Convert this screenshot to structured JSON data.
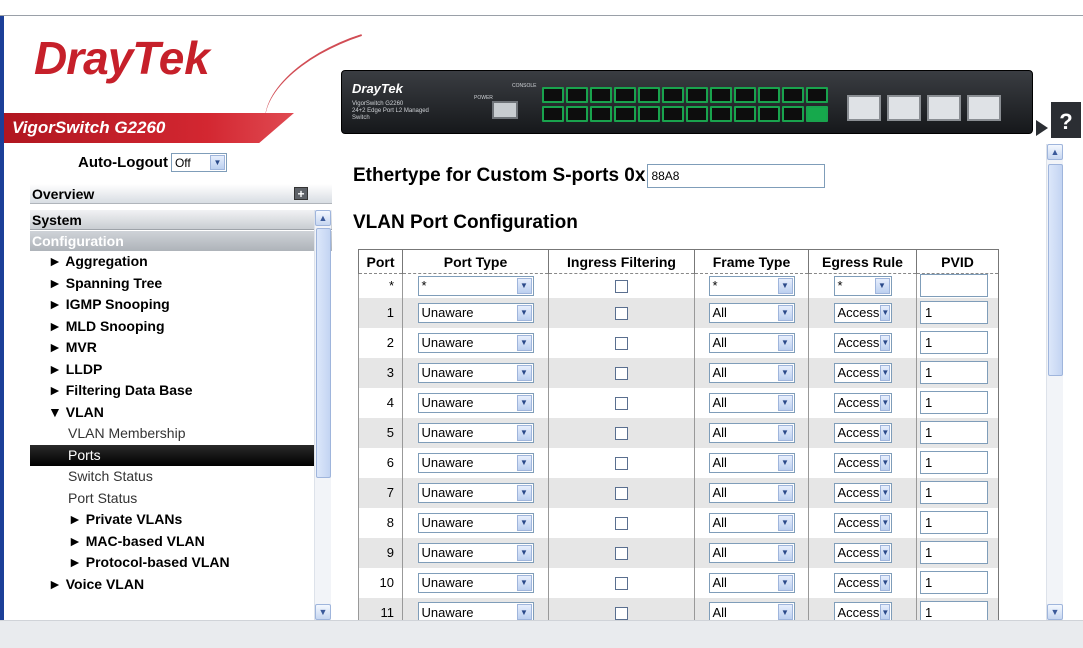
{
  "brand": {
    "logo_dray": "Dray",
    "logo_tek": "Tek",
    "model": "VigorSwitch G2260"
  },
  "device": {
    "brand": "DrayTek",
    "model_text": "VigorSwitch G2260",
    "model_sub": "24+2 Edge Port L2 Managed Switch",
    "power_label": "POWER",
    "console_label": "CONSOLE"
  },
  "help": {
    "label": "?"
  },
  "sidebar": {
    "autologout_label": "Auto-Logout",
    "autologout_value": "Off",
    "overview": "Overview",
    "system": "System",
    "configuration": "Configuration",
    "items": [
      {
        "label": "► Aggregation",
        "level": 1
      },
      {
        "label": "► Spanning Tree",
        "level": 1
      },
      {
        "label": "► IGMP Snooping",
        "level": 1
      },
      {
        "label": "► MLD Snooping",
        "level": 1
      },
      {
        "label": "► MVR",
        "level": 1
      },
      {
        "label": "► LLDP",
        "level": 1
      },
      {
        "label": "► Filtering Data Base",
        "level": 1
      },
      {
        "label": "▼ VLAN",
        "level": 1
      },
      {
        "label": "VLAN Membership",
        "level": 2
      },
      {
        "label": "Ports",
        "level": 2,
        "active": true
      },
      {
        "label": "Switch Status",
        "level": 2
      },
      {
        "label": "Port Status",
        "level": 2
      },
      {
        "label": "► Private VLANs",
        "level": 3
      },
      {
        "label": "► MAC-based VLAN",
        "level": 3
      },
      {
        "label": "► Protocol-based VLAN",
        "level": 3
      },
      {
        "label": "► Voice VLAN",
        "level": 1
      }
    ]
  },
  "main": {
    "ethertype_label": "Ethertype for Custom S-ports 0x",
    "ethertype_value": "88A8",
    "title": "VLAN Port Configuration",
    "columns": [
      "Port",
      "Port Type",
      "Ingress Filtering",
      "Frame Type",
      "Egress Rule",
      "PVID"
    ],
    "wildcard_row": {
      "port": "*",
      "port_type": "*",
      "frame_type": "*",
      "egress_rule": "*",
      "pvid": ""
    },
    "rows": [
      {
        "port": "1",
        "port_type": "Unaware",
        "frame_type": "All",
        "egress_rule": "Access",
        "pvid": "1"
      },
      {
        "port": "2",
        "port_type": "Unaware",
        "frame_type": "All",
        "egress_rule": "Access",
        "pvid": "1"
      },
      {
        "port": "3",
        "port_type": "Unaware",
        "frame_type": "All",
        "egress_rule": "Access",
        "pvid": "1"
      },
      {
        "port": "4",
        "port_type": "Unaware",
        "frame_type": "All",
        "egress_rule": "Access",
        "pvid": "1"
      },
      {
        "port": "5",
        "port_type": "Unaware",
        "frame_type": "All",
        "egress_rule": "Access",
        "pvid": "1"
      },
      {
        "port": "6",
        "port_type": "Unaware",
        "frame_type": "All",
        "egress_rule": "Access",
        "pvid": "1"
      },
      {
        "port": "7",
        "port_type": "Unaware",
        "frame_type": "All",
        "egress_rule": "Access",
        "pvid": "1"
      },
      {
        "port": "8",
        "port_type": "Unaware",
        "frame_type": "All",
        "egress_rule": "Access",
        "pvid": "1"
      },
      {
        "port": "9",
        "port_type": "Unaware",
        "frame_type": "All",
        "egress_rule": "Access",
        "pvid": "1"
      },
      {
        "port": "10",
        "port_type": "Unaware",
        "frame_type": "All",
        "egress_rule": "Access",
        "pvid": "1"
      },
      {
        "port": "11",
        "port_type": "Unaware",
        "frame_type": "All",
        "egress_rule": "Access",
        "pvid": "1"
      }
    ]
  },
  "colors": {
    "brand_red": "#c6202a",
    "active_bg": "#000000",
    "row_alt": "#e6e6e6",
    "left_bar": "#1c3f98"
  }
}
